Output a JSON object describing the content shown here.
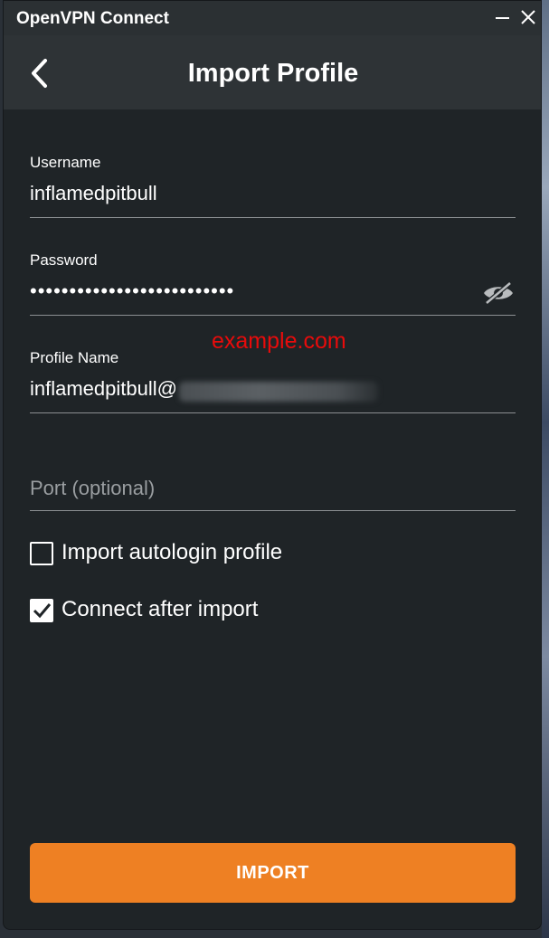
{
  "window": {
    "title": "OpenVPN Connect",
    "minimize_icon": "minimize-icon",
    "close_icon": "close-icon"
  },
  "header": {
    "title": "Import Profile",
    "back_icon": "chevron-left-icon"
  },
  "form": {
    "username": {
      "label": "Username",
      "value": "inflamedpitbull"
    },
    "password": {
      "label": "Password",
      "value": "••••••••••••••••••••••••••",
      "toggle_icon": "eye-slash-icon"
    },
    "profile_name": {
      "label": "Profile Name",
      "value": "inflamedpitbull@"
    },
    "port": {
      "placeholder": "Port (optional)",
      "value": ""
    }
  },
  "watermark": "example.com",
  "options": {
    "autologin": {
      "label": "Import autologin profile",
      "checked": false
    },
    "connect_after": {
      "label": "Connect after import",
      "checked": true
    }
  },
  "import_button": {
    "label": "IMPORT"
  },
  "colors": {
    "accent": "#ee8023",
    "background": "#1f2427",
    "header": "#2e3336",
    "watermark": "#e80b0b"
  }
}
